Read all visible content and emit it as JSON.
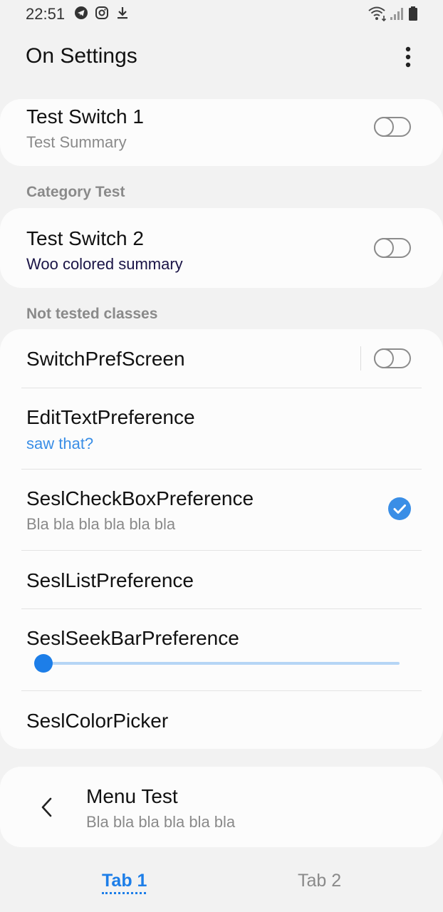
{
  "status_bar": {
    "time": "22:51",
    "left_icons": [
      "telegram-icon",
      "instagram-icon",
      "download-icon"
    ],
    "right_icons": [
      "wifi-icon",
      "signal-icon",
      "battery-icon"
    ]
  },
  "app_bar": {
    "title": "On Settings",
    "more_icon": "more-vertical-icon"
  },
  "prefs": {
    "switch1": {
      "title": "Test Switch 1",
      "summary": "Test Summary",
      "checked": false
    },
    "category_test": "Category Test",
    "switch2": {
      "title": "Test Switch 2",
      "summary": "Woo colored summary",
      "summary_color": "#1a1446",
      "checked": false
    },
    "category_not_tested": "Not tested classes",
    "switch_pref_screen": {
      "title": "SwitchPrefScreen",
      "checked": false
    },
    "edit_text": {
      "title": "EditTextPreference",
      "summary": "saw that?",
      "summary_color": "#3a8ee6"
    },
    "checkbox": {
      "title": "SeslCheckBoxPreference",
      "summary": "Bla bla bla bla bla bla",
      "checked": true
    },
    "list": {
      "title": "SeslListPreference"
    },
    "seekbar": {
      "title": "SeslSeekBarPreference",
      "value_fraction": 0
    },
    "color_picker": {
      "title": "SeslColorPicker"
    },
    "menu_test": {
      "title": "Menu Test",
      "summary": "Bla bla bla bla bla bla",
      "icon": "chevron-left-icon"
    }
  },
  "tabs": [
    {
      "label": "Tab 1",
      "selected": true
    },
    {
      "label": "Tab 2",
      "selected": false
    }
  ],
  "colors": {
    "accent": "#1d7ee8",
    "background": "#f2f2f2",
    "card": "#fcfcfc",
    "secondary_text": "#8a8a8a"
  }
}
